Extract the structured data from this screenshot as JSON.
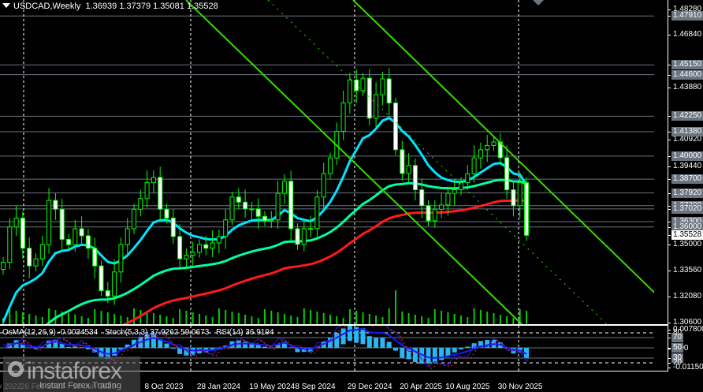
{
  "header": {
    "symbol_timeframe": "USDCAD,Weekly",
    "ohlc": "1.36939 1.37379 1.35081 1.35528"
  },
  "indicator_panel": {
    "osma": "OsMA(12,26,9) -0.0034534",
    "stoch": "Stoch(5,3,3) 37.9262 59.0673",
    "rsi": "RSI(14) 36.9194",
    "axis": {
      "top": "0.007800",
      "zero": "0.00",
      "bottom": "-0.011505",
      "levels": [
        "80",
        "70",
        "50",
        "30",
        "20"
      ]
    }
  },
  "watermark": {
    "logo": "instaforex",
    "tagline": "Instant Forex Trading"
  },
  "colors": {
    "bull": "#00ff00",
    "ma_fast": "#00e5ff",
    "ma_mid": "#00ffa0",
    "ma_slow": "#ff1a1a",
    "trend": "#33dd00",
    "hline": "#6b7580"
  },
  "chart_data": {
    "type": "candlestick",
    "title": "USDCAD,Weekly",
    "ylim": [
      1.306,
      1.4828
    ],
    "price_ticks": [
      "1.48280",
      "1.46840",
      "1.43880",
      "1.40920",
      "1.39440",
      "1.35000",
      "1.33560",
      "1.32080",
      "1.30600"
    ],
    "level_lines": [
      "1.47910",
      "1.45150",
      "1.44600",
      "1.42250",
      "1.41380",
      "1.40000",
      "1.38700",
      "1.37920",
      "1.37200",
      "1.37020",
      "1.36300",
      "1.36000"
    ],
    "current_price": "1.35528",
    "x_labels": [
      "6 Nov 2022",
      "26 Feb 2023",
      "18 Jun 2023",
      "8 Oct 2023",
      "28 Jan 2024",
      "19 May 2024",
      "8 Sep 2024",
      "29 Dec 2024",
      "20 Apr 2025",
      "10 Aug 2025",
      "30 Nov 2025"
    ],
    "x_label_index": [
      0,
      6,
      14,
      25,
      33,
      41,
      48,
      56,
      64,
      71,
      79
    ],
    "sampling": "bi-weekly closes (approx.)",
    "closes": [
      1.34,
      1.36,
      1.365,
      1.348,
      1.338,
      1.342,
      1.35,
      1.375,
      1.37,
      1.353,
      1.35,
      1.359,
      1.355,
      1.348,
      1.338,
      1.324,
      1.321,
      1.3346,
      1.35,
      1.359,
      1.37,
      1.376,
      1.385,
      1.388,
      1.37,
      1.365,
      1.3546,
      1.342,
      1.344,
      1.3457,
      1.35,
      1.348,
      1.351,
      1.3546,
      1.364,
      1.3769,
      1.374,
      1.3702,
      1.3702,
      1.366,
      1.3635,
      1.364,
      1.379,
      1.3858,
      1.359,
      1.3502,
      1.3591,
      1.3591,
      1.3769,
      1.3902,
      1.399,
      1.414,
      1.43,
      1.443,
      1.437,
      1.444,
      1.4214,
      1.4347,
      1.4436,
      1.43,
      1.4036,
      1.3902,
      1.3947,
      1.381,
      1.372,
      1.3635,
      1.37,
      1.3724,
      1.379,
      1.381,
      1.385,
      1.39,
      1.399,
      1.4036,
      1.406,
      1.408,
      1.3991,
      1.381,
      1.372,
      1.385,
      1.35528
    ],
    "moving_averages": [
      {
        "name": "fast MA",
        "color": "#00e5ff"
      },
      {
        "name": "medium MA",
        "color": "#00ffa0"
      },
      {
        "name": "slow MA",
        "color": "#ff1a1a"
      }
    ]
  }
}
